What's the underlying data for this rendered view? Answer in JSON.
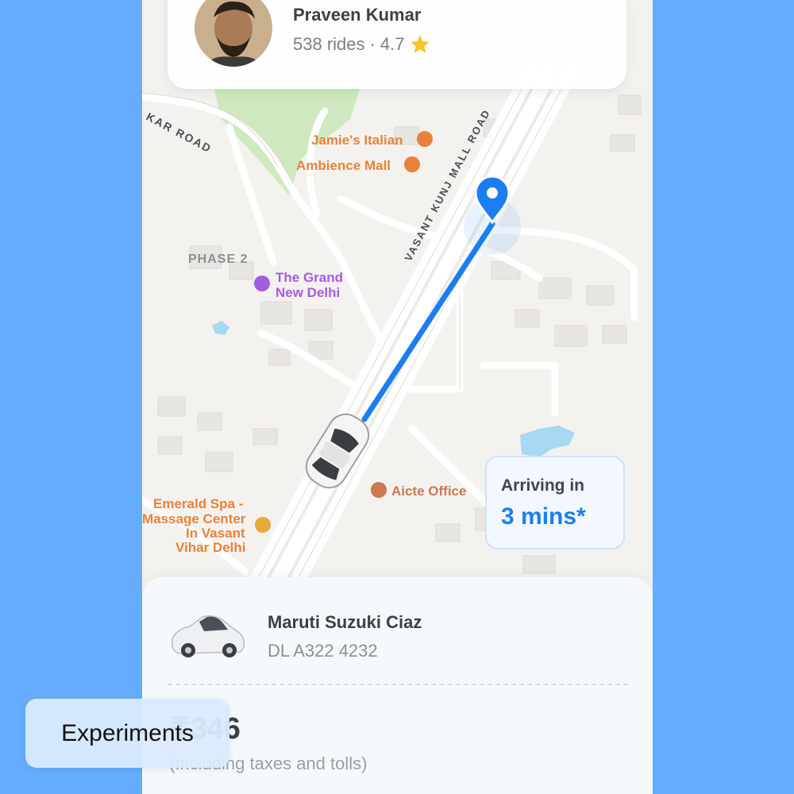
{
  "driver": {
    "name": "Praveen Kumar",
    "rides": "538 rides",
    "separator": "·",
    "rating": "4.7"
  },
  "map": {
    "labels": {
      "kar_road": "KAR ROAD",
      "mall_road": "VASANT KUNJ MALL ROAD",
      "jamies": "Jamie's Italian",
      "ambience": "Ambience Mall",
      "phase2": "PHASE 2",
      "grand_1": "The Grand",
      "grand_2": "New Delhi",
      "emerald_1": "Emerald Spa -",
      "emerald_2": "Massage Center",
      "emerald_3": "In Vasant",
      "emerald_4": "Vihar Delhi",
      "aicte": "Aicte Office"
    },
    "colors": {
      "route": "#1a7ef2",
      "pin": "#1a7ef2",
      "poi_orange": "#e8823a",
      "poi_purple": "#a35de0"
    }
  },
  "eta": {
    "label": "Arriving in",
    "value": "3 mins*"
  },
  "vehicle": {
    "model": "Maruti Suzuki Ciaz",
    "plate": "DL A322 4232"
  },
  "fare": {
    "amount": "₹346",
    "note": "(Including taxes and tolls)"
  },
  "overlay": {
    "experiments_label": "Experiments"
  }
}
